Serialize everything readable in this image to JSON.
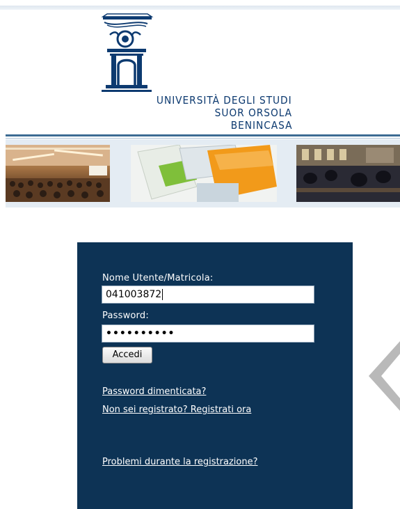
{
  "header": {
    "university_name_line1": "UNIVERSITÀ DEGLI STUDI",
    "university_name_line2": "SUOR ORSOLA",
    "university_name_line3": "BENINCASA"
  },
  "banner": {
    "images": [
      "auditorium-photo",
      "brochures-photo",
      "library-photo"
    ]
  },
  "login": {
    "username_label": "Nome Utente/Matricola:",
    "username_value": "041003872",
    "password_label": "Password:",
    "password_value": "••••••••••",
    "submit_label": "Accedi",
    "forgot_password_link": "Password dimenticata?",
    "register_link": "Non sei registrato? Registrati ora",
    "registration_problems_link": "Problemi durante la registrazione?"
  },
  "colors": {
    "panel_bg": "#0d3355",
    "logo_blue": "#0d3a70"
  }
}
